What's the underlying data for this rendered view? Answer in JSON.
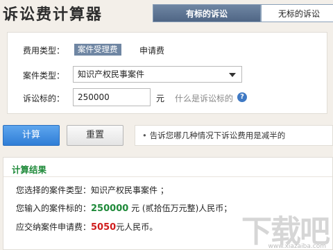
{
  "header": {
    "app_title": "诉讼费计算器",
    "tabs": [
      {
        "label": "有标的诉讼",
        "active": true
      },
      {
        "label": "无标的诉讼",
        "active": false
      }
    ]
  },
  "form": {
    "fee_type": {
      "label": "费用类型：",
      "options": [
        "案件受理费",
        "申请费"
      ],
      "selected": "案件受理费"
    },
    "case_type": {
      "label": "案件类型：",
      "selected": "知识产权民事案件"
    },
    "amount": {
      "label": "诉讼标的：",
      "value": "250000",
      "unit": "元",
      "help_text": "什么是诉讼标的",
      "help_icon": "question-circle-icon"
    }
  },
  "buttons": {
    "calculate": "计算",
    "reset": "重置"
  },
  "tip": {
    "bullet": "•",
    "text": "告诉您哪几种情况下诉讼费用是减半的"
  },
  "result": {
    "title": "计算结果",
    "line1_prefix": "您选择的案件类型：",
    "line1_value": "知识产权民事案件",
    "line1_suffix": " ；",
    "line2_prefix": "您输入的案件标的：",
    "line2_value": "250000",
    "line2_suffix": " 元 (贰拾伍万元整)人民币；",
    "line3_prefix": "应交纳案件申请费：",
    "line3_value": "5050",
    "line3_suffix": "元人民币。"
  },
  "watermark": {
    "text": "下载吧",
    "sub": "www.xiazaiba.com"
  },
  "colors": {
    "tab_active": "#5b7292",
    "calc_button": "#3f8fe2",
    "result_title": "#1f8a3a",
    "amount_value": "#1f8a3a",
    "fee_value": "#d01c1c"
  }
}
